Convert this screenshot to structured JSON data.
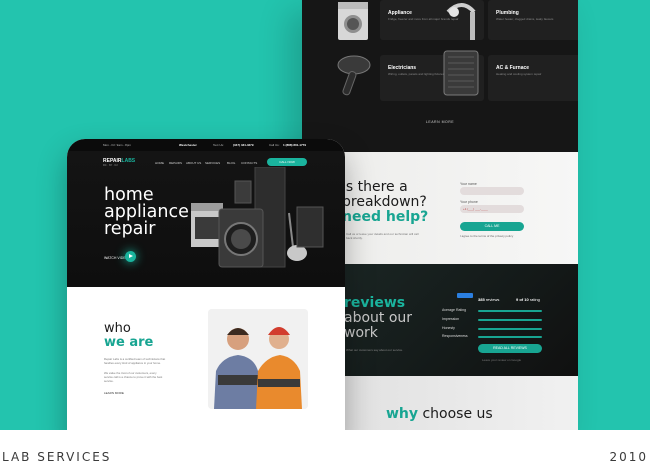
{
  "back_page": {
    "services": [
      {
        "title": "Appliance",
        "desc": "Fridge, freezer and more from all major brands repair"
      },
      {
        "title": "Plumbing",
        "desc": "Water heater, clogged drains, leaky faucets"
      },
      {
        "title": "Electricians",
        "desc": "Wiring, outlets, panels and lighting fixtures"
      },
      {
        "title": "AC & Furnace",
        "desc": "Heating and cooling system repair"
      }
    ],
    "learn_more": "LEARN MORE",
    "question_lines": [
      "is there a",
      "breakdown?",
      "need help?"
    ],
    "question_text": "Call us or leave your details and our technician will call back shortly.",
    "form": {
      "name_label": "Your name",
      "phone_label": "Your phone",
      "phone_placeholder": "+1 (___) ___-____",
      "button": "CALL ME",
      "checkbox": "I agree to the terms of the privacy policy"
    },
    "reviews_lines": [
      "reviews",
      "about our",
      "work"
    ],
    "reviews_text": "What our customers say about our service.",
    "reviews_badge": "Google",
    "reviews_count": "385",
    "reviews_count_label": "reviews",
    "reviews_rating": "9 of 10",
    "reviews_rating_label": "rating",
    "rating_rows": [
      "Average Rating",
      "Impression",
      "Honesty",
      "Responsiveness"
    ],
    "reviews_button": "READ ALL REVIEWS",
    "reviews_note": "Leave your review on Google",
    "why_prefix": "why",
    "why_rest": "choose us"
  },
  "front_page": {
    "topbar": {
      "left": "Mon - Fri: 9am - 8pm",
      "brand": "Westchester",
      "phone_label": "Text Us:",
      "phone": "(347) 434-4279",
      "phone2_label": "Call Us:",
      "phone2": "1 (888) 801-1779"
    },
    "logo_main": "REPAIR",
    "logo_accent": "LABS",
    "logo_sub": "DC · NY · NJ",
    "nav": [
      "HOME",
      "REPAIRS",
      "ABOUT US",
      "SERVICES",
      "BLOG",
      "CONTACTS"
    ],
    "call_button": "CALL NOW",
    "hero_lines": [
      "home",
      "appliance",
      "repair"
    ],
    "watch_label": "WATCH VIDEO",
    "who_lines": [
      "who",
      "we are"
    ],
    "who_p1": "Repair Labs is a certified team of technicians that handles every kind of appliance in your home.",
    "who_p2": "We value the trust of our customers, every service call is a chance to prove it with the best service.",
    "who_learn": "LEARN MORE"
  },
  "footer": {
    "left": "LAB SERVICES",
    "right": "2010"
  },
  "colors": {
    "background": "#23c4ae",
    "accent": "#18a592",
    "dark": "#141414"
  }
}
